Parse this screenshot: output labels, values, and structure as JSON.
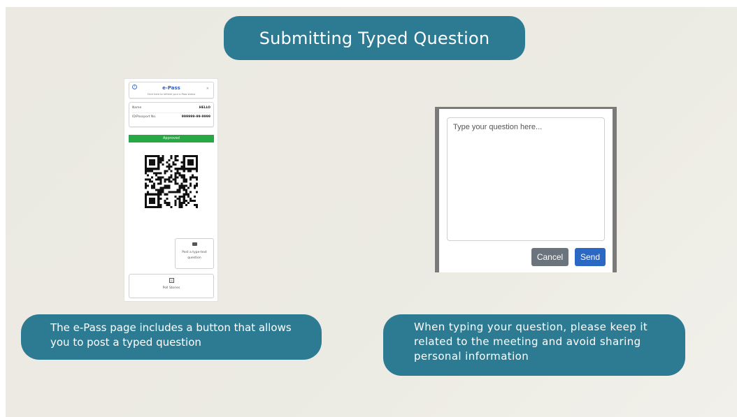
{
  "slide": {
    "title": "Submitting Typed Question",
    "caption_left": "The e-Pass page includes a button that allows you to post a typed question",
    "caption_right": "When typing your question, please keep it related to the meeting and avoid sharing personal information"
  },
  "epass": {
    "info_glyph": "i",
    "title": "e-Pass",
    "subtitle": "Click here to refresh your e-Pass status",
    "close_glyph": "×",
    "fields": [
      {
        "label": "Name",
        "value": "HELLO"
      },
      {
        "label": "ID/Passport No.",
        "value": "999999-99-9999"
      }
    ],
    "status": "Approved",
    "post_button_label": "Post a type-text question",
    "poll_icon_glyph": "☑",
    "poll_button_label": "Poll Stories"
  },
  "dialog": {
    "placeholder": "Type your question here...",
    "cancel_label": "Cancel",
    "send_label": "Send"
  },
  "colors": {
    "accent": "#2d7b92",
    "approved": "#28a745",
    "send": "#2a68c4",
    "cancel": "#6b747c"
  }
}
